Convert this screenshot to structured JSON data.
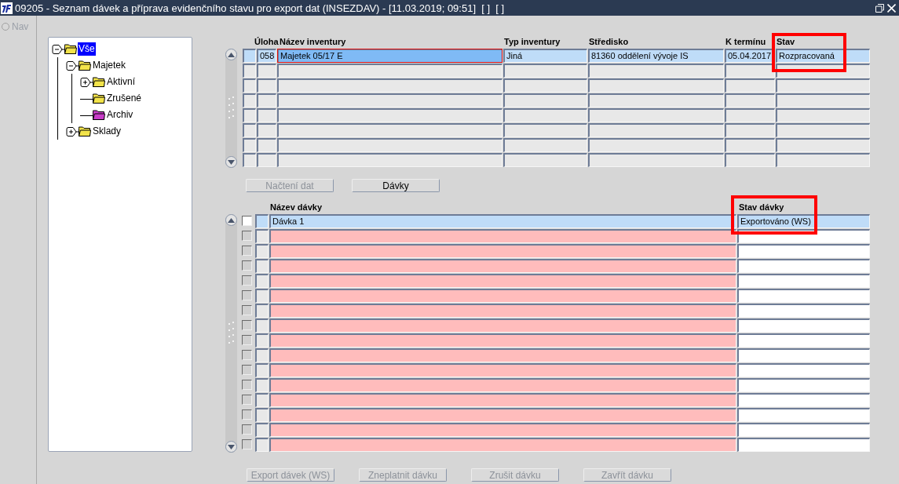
{
  "window": {
    "title": "09205 - Seznam dávek a příprava evidenčního stavu pro export dat (INSEZDAV) - [11.03.2019; 09:51]  [ ]  [ ]"
  },
  "nav": {
    "label": "Nav",
    "checked": false
  },
  "tree": [
    {
      "label": "Vše",
      "color": "#f2e34a",
      "expanded": true,
      "selected": true,
      "children": [
        {
          "label": "Majetek",
          "color": "#f2e34a",
          "expanded": true,
          "selected": false,
          "children": [
            {
              "label": "Aktivní",
              "color": "#f2e34a",
              "expanded": false,
              "selected": false
            },
            {
              "label": "Zrušené",
              "color": "#f2e34a",
              "selected": false
            },
            {
              "label": "Archiv",
              "color": "#c83cc8",
              "selected": false
            }
          ]
        },
        {
          "label": "Sklady",
          "color": "#f2e34a",
          "expanded": false,
          "selected": false
        }
      ]
    }
  ],
  "inventories": {
    "columns": [
      {
        "label": "Úloha",
        "annotated": false
      },
      {
        "label": "Název inventury",
        "annotated": false
      },
      {
        "label": "Typ inventury",
        "annotated": false
      },
      {
        "label": "Středisko",
        "annotated": false
      },
      {
        "label": "K termínu",
        "annotated": false
      },
      {
        "label": "Stav",
        "annotated": true
      }
    ],
    "rows": [
      {
        "selected": true,
        "cells": [
          {
            "text": "058",
            "focused": false
          },
          {
            "text": "Majetek 05/17 E",
            "focused": true
          },
          {
            "text": "Jiná",
            "focused": false
          },
          {
            "text": "81360 oddělení vývoje IS",
            "focused": false
          },
          {
            "text": "05.04.2017",
            "focused": false
          },
          {
            "text": "Rozpracovaná",
            "focused": false
          }
        ]
      },
      {
        "selected": false
      },
      {
        "selected": false
      },
      {
        "selected": false
      },
      {
        "selected": false
      },
      {
        "selected": false
      },
      {
        "selected": false
      },
      {
        "selected": false
      }
    ]
  },
  "grid_buttons": [
    {
      "label": "Načtení dat",
      "disabled": true
    },
    {
      "label": "Dávky",
      "disabled": false
    }
  ],
  "batches": {
    "columns": [
      {
        "label": "Název dávky",
        "required": true,
        "annotated": false
      },
      {
        "label": "Stav dávky",
        "required": false,
        "annotated": true
      }
    ],
    "rows": [
      {
        "selected": true,
        "checked": false,
        "cells": [
          "Dávka 1",
          "Exportováno (WS)"
        ]
      },
      {
        "selected": false,
        "checked": false
      },
      {
        "selected": false,
        "checked": false
      },
      {
        "selected": false,
        "checked": false
      },
      {
        "selected": false,
        "checked": false
      },
      {
        "selected": false,
        "checked": false
      },
      {
        "selected": false,
        "checked": false
      },
      {
        "selected": false,
        "checked": false
      },
      {
        "selected": false,
        "checked": false
      },
      {
        "selected": false,
        "checked": false
      },
      {
        "selected": false,
        "checked": false
      },
      {
        "selected": false,
        "checked": false
      },
      {
        "selected": false,
        "checked": false
      },
      {
        "selected": false,
        "checked": false
      },
      {
        "selected": false,
        "checked": false
      },
      {
        "selected": false,
        "checked": false
      }
    ]
  },
  "batch_buttons": [
    {
      "label": "Export dávek (WS)",
      "disabled": true
    },
    {
      "label": "Zneplatnit dávku",
      "disabled": true
    },
    {
      "label": "Zrušit dávku",
      "disabled": true
    },
    {
      "label": "Zavřít dávku",
      "disabled": true
    }
  ]
}
